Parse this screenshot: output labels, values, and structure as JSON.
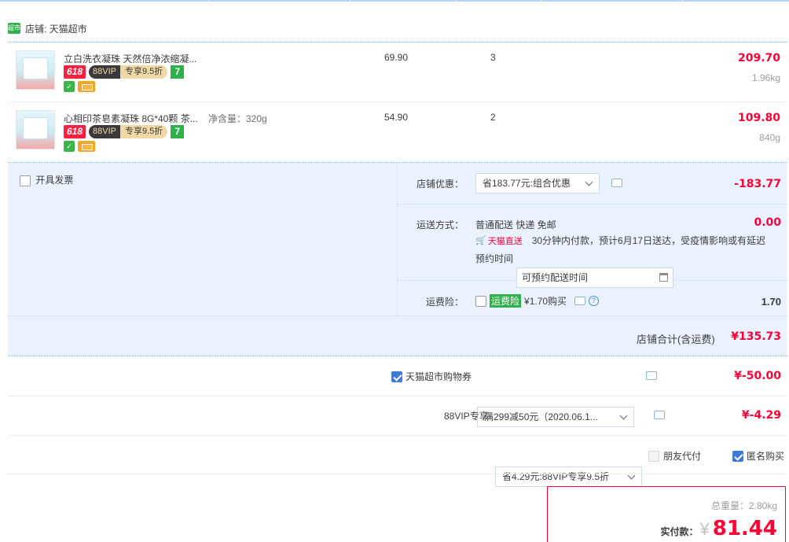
{
  "shop": {
    "label": "店铺: 天猫超市",
    "logo_text": "超市"
  },
  "items": [
    {
      "title": "立白洗衣凝珠 天然倍净浓缩凝...",
      "sku": "",
      "badge_618": "618",
      "badge_vip_left": "88VIP",
      "badge_vip_right": "专享9.5折",
      "badge_7": "7",
      "price": "69.90",
      "qty": "3",
      "subtotal": "209.70",
      "weight": "1.96kg"
    },
    {
      "title": "心相印茶皂素凝珠 8G*40颗 茶...",
      "sku": "净含量：320g",
      "badge_618": "618",
      "badge_vip_left": "88VIP",
      "badge_vip_right": "专享9.5折",
      "badge_7": "7",
      "price": "54.90",
      "qty": "2",
      "subtotal": "109.80",
      "weight": "840g"
    }
  ],
  "invoice": {
    "label": "开具发票"
  },
  "shop_discount": {
    "label": "店铺优惠：",
    "selected": "省183.77元:组合优惠",
    "amount": "-183.77"
  },
  "delivery": {
    "label": "运送方式：",
    "method": "普通配送 快递 免邮",
    "amount": "0.00",
    "brand": "天猫直送",
    "note": "30分钟内付款，预计6月17日送达，受疫情影响或有延迟",
    "appoint_label": "预约时间",
    "appoint_placeholder": "可预约配送时间"
  },
  "insurance": {
    "label": "运费险：",
    "tag": "运费险",
    "price": "¥1.70购买",
    "amount": "1.70"
  },
  "shop_total": {
    "label": "店铺合计(含运费)",
    "amount": "¥135.73"
  },
  "coupon": {
    "label": "天猫超市购物券",
    "selected": "满299减50元（2020.06.1...",
    "amount": "¥-50.00",
    "checked": true
  },
  "vip": {
    "label": "88VIP专享",
    "selected": "省4.29元:88VIP专享9.5折",
    "amount": "¥-4.29"
  },
  "options": {
    "friend_pay": "朋友代付",
    "anonymous": "匿名购买"
  },
  "summary": {
    "weight_label": "总重量：2.80kg",
    "pay_label": "实付款：",
    "currency": "¥",
    "amount": "81.44"
  },
  "colors": {
    "accent": "#ff0036",
    "panel": "#eaf2ff",
    "dotted": "#80b2ff"
  }
}
